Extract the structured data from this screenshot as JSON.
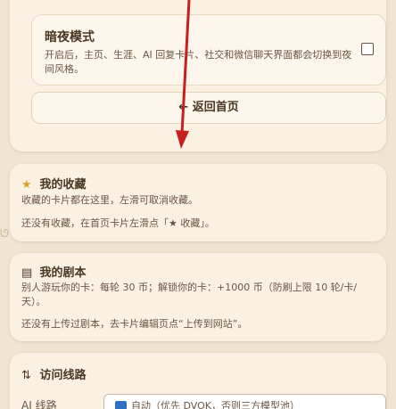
{
  "settings": {
    "dark_mode": {
      "title": "暗夜模式",
      "description": "开启后，主页、生涯、AI 回复卡片、社交和微信聊天界面都会切换到夜间风格。",
      "checked": false
    },
    "back_button": "← 返回首页"
  },
  "favorites": {
    "icon": "☆",
    "title": "我的收藏",
    "hint": "收藏的卡片都在这里，左滑可取消收藏。",
    "empty": "还没有收藏，在首页卡片左滑点「★ 收藏」。"
  },
  "scripts": {
    "icon": "▤",
    "title": "我的剧本",
    "hint": "别人游玩你的卡：每轮 30 币；解锁你的卡：+1000 币（防刷上限 10 轮/卡/天）。",
    "empty": "还没有上传过剧本，去卡片编辑页点“上传到网站”。"
  },
  "route": {
    "icon": "⇅",
    "title": "访问线路",
    "ai_label": "AI 线路",
    "ai_value": "自动（优先 DVOK，否则三方模型池）"
  },
  "colors": {
    "accent_arrow": "#c81e1e",
    "card_bg": "#fbf1e3",
    "page_bg": "#f0e4d2"
  }
}
